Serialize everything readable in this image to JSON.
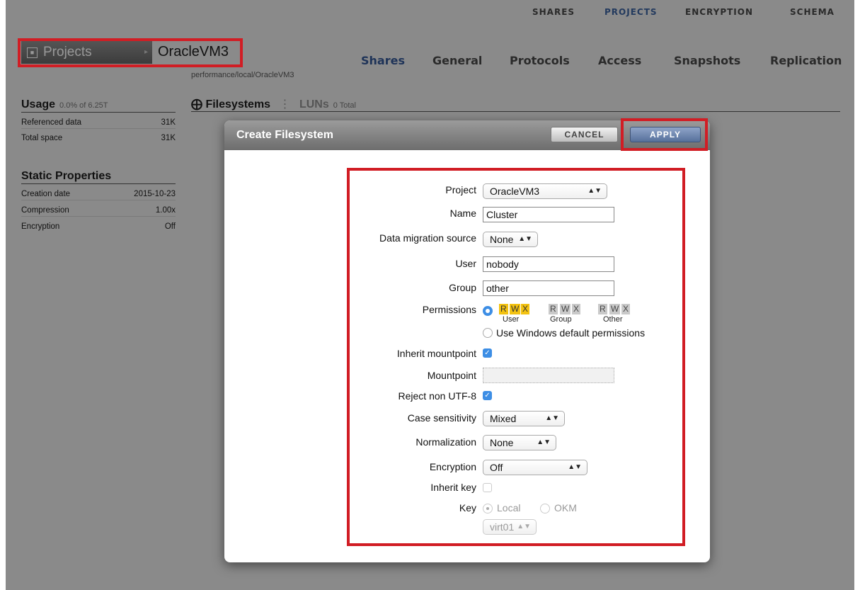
{
  "topnav": {
    "items": [
      {
        "label": "SHARES"
      },
      {
        "label": "PROJECTS"
      },
      {
        "label": "ENCRYPTION"
      },
      {
        "label": "SCHEMA"
      }
    ]
  },
  "header": {
    "projects_label": "Projects",
    "project_name": "OracleVM3",
    "path": "performance/local/OracleVM3"
  },
  "tabs": [
    {
      "label": "Shares"
    },
    {
      "label": "General"
    },
    {
      "label": "Protocols"
    },
    {
      "label": "Access"
    },
    {
      "label": "Snapshots"
    },
    {
      "label": "Replication"
    }
  ],
  "usage": {
    "title": "Usage",
    "summary": "0.0% of 6.25T",
    "rows": [
      {
        "label": "Referenced data",
        "value": "31K"
      },
      {
        "label": "Total space",
        "value": "31K"
      }
    ]
  },
  "static_properties": {
    "title": "Static Properties",
    "rows": [
      {
        "label": "Creation date",
        "value": "2015-10-23"
      },
      {
        "label": "Compression",
        "value": "1.00x"
      },
      {
        "label": "Encryption",
        "value": "Off"
      }
    ]
  },
  "shares_bar": {
    "filesystems": "Filesystems",
    "luns": "LUNs",
    "luns_total": "0 Total"
  },
  "dialog": {
    "title": "Create Filesystem",
    "cancel": "CANCEL",
    "apply": "APPLY",
    "fields": {
      "project_label": "Project",
      "project_value": "OracleVM3",
      "name_label": "Name",
      "name_value": "Cluster",
      "migration_label": "Data migration source",
      "migration_value": "None",
      "user_label": "User",
      "user_value": "nobody",
      "group_label": "Group",
      "group_value": "other",
      "permissions_label": "Permissions",
      "perm_user": [
        "R",
        "W",
        "X"
      ],
      "perm_group": [
        "R",
        "W",
        "X"
      ],
      "perm_other": [
        "R",
        "W",
        "X"
      ],
      "perm_user_label": "User",
      "perm_group_label": "Group",
      "perm_other_label": "Other",
      "windows_default": "Use Windows default permissions",
      "inherit_mountpoint_label": "Inherit mountpoint",
      "inherit_mountpoint_checked": true,
      "mountpoint_label": "Mountpoint",
      "mountpoint_value": "",
      "reject_utf8_label": "Reject non UTF-8",
      "reject_utf8_checked": true,
      "case_label": "Case sensitivity",
      "case_value": "Mixed",
      "normalization_label": "Normalization",
      "normalization_value": "None",
      "encryption_label": "Encryption",
      "encryption_value": "Off",
      "inherit_key_label": "Inherit key",
      "inherit_key_checked": false,
      "key_label": "Key",
      "key_local": "Local",
      "key_okm": "OKM",
      "keystore_value": "virt01"
    }
  },
  "colors": {
    "highlight": "#d11d24",
    "apply_button": "#56709b",
    "checkbox": "#3d8ee5",
    "perm_user": "#f3c211"
  },
  "icons": {
    "checkmark": "check-icon",
    "select_arrows": "updown-arrows-icon",
    "filesystems_add": "plus-circle-icon",
    "projects": "projects-icon"
  }
}
